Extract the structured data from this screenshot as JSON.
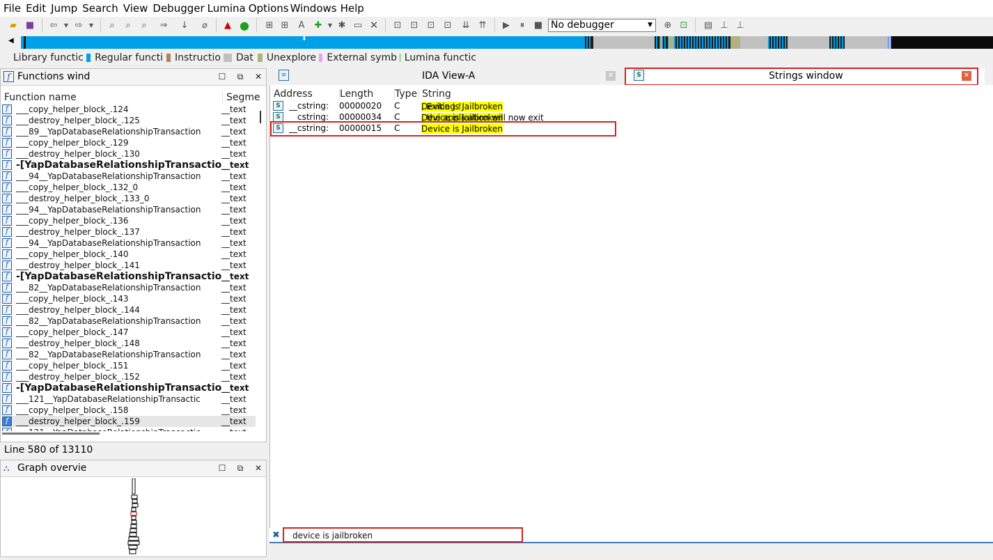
{
  "menu": [
    "File",
    "Edit",
    "Jump",
    "Search",
    "View",
    "Debugger",
    "Lumina",
    "Options",
    "Windows",
    "Help"
  ],
  "toolbar": {
    "debugger_select": "No debugger"
  },
  "legend": [
    {
      "label": "Library functic",
      "color": "#c0f0ff"
    },
    {
      "label": "Regular functi",
      "color": "#00a0e8"
    },
    {
      "label": "Instructio",
      "color": "#b08060"
    },
    {
      "label": "Dat",
      "color": "#c0c0c0"
    },
    {
      "label": "Unexplore",
      "color": "#b0b080"
    },
    {
      "label": "External symb",
      "color": "#f0a0f0"
    },
    {
      "label": "Lumina functic",
      "color": "#30c030"
    }
  ],
  "functions_panel": {
    "title": "Functions windo",
    "col_name": "Function name",
    "col_segment": "Segme",
    "rows": [
      {
        "name": "___copy_helper_block_.124",
        "seg": "__text"
      },
      {
        "name": "___destroy_helper_block_.125",
        "seg": "__text"
      },
      {
        "name": "___89__YapDatabaseRelationshipTransaction",
        "seg": "__text"
      },
      {
        "name": "___copy_helper_block_.129",
        "seg": "__text"
      },
      {
        "name": "___destroy_helper_block_.130",
        "seg": "__text"
      },
      {
        "name": "-[YapDatabaseRelationshipTransaction",
        "seg": "__text",
        "bold": true
      },
      {
        "name": "___94__YapDatabaseRelationshipTransaction",
        "seg": "__text"
      },
      {
        "name": "___copy_helper_block_.132_0",
        "seg": "__text"
      },
      {
        "name": "___destroy_helper_block_.133_0",
        "seg": "__text"
      },
      {
        "name": "___94__YapDatabaseRelationshipTransaction",
        "seg": "__text"
      },
      {
        "name": "___copy_helper_block_.136",
        "seg": "__text"
      },
      {
        "name": "___destroy_helper_block_.137",
        "seg": "__text"
      },
      {
        "name": "___94__YapDatabaseRelationshipTransaction",
        "seg": "__text"
      },
      {
        "name": "___copy_helper_block_.140",
        "seg": "__text"
      },
      {
        "name": "___destroy_helper_block_.141",
        "seg": "__text"
      },
      {
        "name": "-[YapDatabaseRelationshipTransaction",
        "seg": "__text",
        "bold": true
      },
      {
        "name": "___82__YapDatabaseRelationshipTransaction",
        "seg": "__text"
      },
      {
        "name": "___copy_helper_block_.143",
        "seg": "__text"
      },
      {
        "name": "___destroy_helper_block_.144",
        "seg": "__text"
      },
      {
        "name": "___82__YapDatabaseRelationshipTransaction",
        "seg": "__text"
      },
      {
        "name": "___copy_helper_block_.147",
        "seg": "__text"
      },
      {
        "name": "___destroy_helper_block_.148",
        "seg": "__text"
      },
      {
        "name": "___82__YapDatabaseRelationshipTransaction",
        "seg": "__text"
      },
      {
        "name": "___copy_helper_block_.151",
        "seg": "__text"
      },
      {
        "name": "___destroy_helper_block_.152",
        "seg": "__text"
      },
      {
        "name": "-[YapDatabaseRelationshipTransaction",
        "seg": "__text",
        "bold": true
      },
      {
        "name": "___121__YapDatabaseRelationshipTransactic",
        "seg": "__text"
      },
      {
        "name": "___copy_helper_block_.158",
        "seg": "__text"
      },
      {
        "name": "___destroy_helper_block_.159",
        "seg": "__text",
        "selected": true
      },
      {
        "name": "___121__YapDatabaseRelationshipTransactic",
        "seg": "__text"
      }
    ]
  },
  "status": {
    "line_info": "Line 580 of 13110"
  },
  "graph_panel": {
    "title": "Graph overvie"
  },
  "tabs": {
    "ida_view": "IDA View-A",
    "strings": "Strings window"
  },
  "strings_panel": {
    "col_address": "Address",
    "col_length": "Length",
    "col_type": "Type",
    "col_string": "String",
    "rows": [
      {
        "address": "__cstring:",
        "length": "00000020",
        "type": "C",
        "match": "Device is Jailbroken",
        "rest": ", Exiting !"
      },
      {
        "address": "__cstring:",
        "length": "00000034",
        "type": "C",
        "match": "Device is Jailbroken",
        "rest": ", the application will now exit"
      },
      {
        "address": "__cstring:",
        "length": "00000015",
        "type": "C",
        "match": "Device is Jailbroken",
        "rest": ""
      }
    ]
  },
  "search": {
    "value": "device is jailbroken"
  }
}
